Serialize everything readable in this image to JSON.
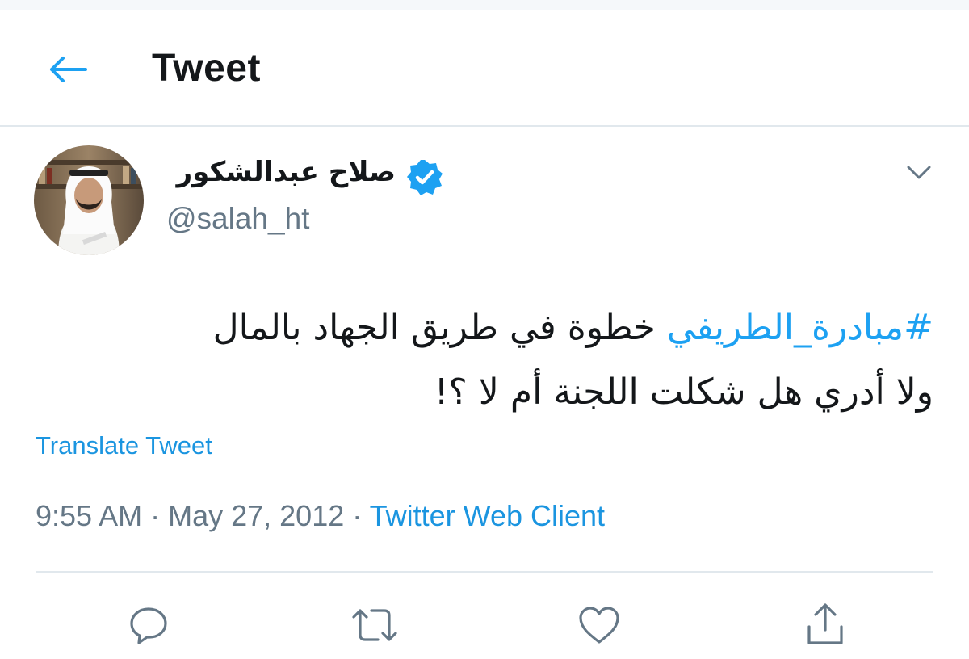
{
  "header": {
    "title": "Tweet",
    "back_icon": "arrow-left-icon",
    "accent_color": "#1da1f2"
  },
  "tweet": {
    "display_name": "صلاح عبدالشكور",
    "verified": true,
    "handle": "@salah_ht",
    "hashtag": "#مبادرة_الطريفي",
    "text_line1_rest": " خطوة في طريق الجهاد بالمال",
    "text_line2": "ولا أدري هل شكلت اللجنة أم لا ؟!",
    "translate_label": "Translate Tweet",
    "time": "9:55 AM",
    "separator": " · ",
    "date": "May 27, 2012",
    "source": "Twitter Web Client"
  },
  "actions": [
    {
      "name": "reply",
      "icon": "reply-icon"
    },
    {
      "name": "retweet",
      "icon": "retweet-icon"
    },
    {
      "name": "like",
      "icon": "heart-icon"
    },
    {
      "name": "share",
      "icon": "share-icon"
    }
  ],
  "colors": {
    "link": "#1b95e0",
    "secondary_text": "#657786",
    "divider": "#e1e8ed"
  }
}
